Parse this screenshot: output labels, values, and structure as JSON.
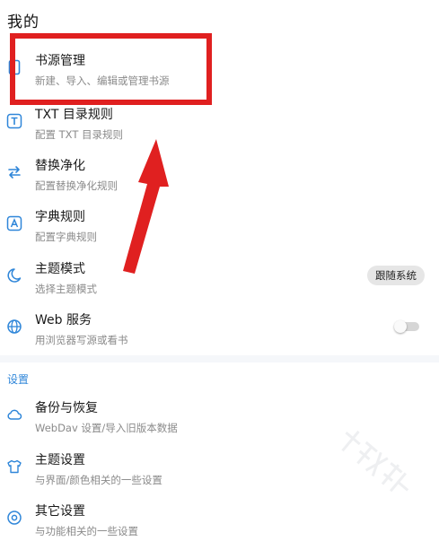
{
  "page": {
    "title": "我的"
  },
  "menu": [
    {
      "icon": "book-icon",
      "title": "书源管理",
      "subtitle": "新建、导入、编辑或管理书源"
    },
    {
      "icon": "text-rule-icon",
      "title": "TXT 目录规则",
      "subtitle": "配置 TXT 目录规则"
    },
    {
      "icon": "swap-icon",
      "title": "替换净化",
      "subtitle": "配置替换净化规则"
    },
    {
      "icon": "dictionary-icon",
      "title": "字典规则",
      "subtitle": "配置字典规则"
    },
    {
      "icon": "theme-icon",
      "title": "主题模式",
      "subtitle": "选择主题模式",
      "chip": "跟随系统"
    },
    {
      "icon": "globe-icon",
      "title": "Web 服务",
      "subtitle": "用浏览器写源或看书",
      "toggle": false
    }
  ],
  "settings": {
    "header": "设置",
    "items": [
      {
        "icon": "cloud-icon",
        "title": "备份与恢复",
        "subtitle": "WebDav 设置/导入旧版本数据"
      },
      {
        "icon": "shirt-icon",
        "title": "主题设置",
        "subtitle": "与界面/颜色相关的一些设置"
      },
      {
        "icon": "other-settings-icon",
        "title": "其它设置",
        "subtitle": "与功能相关的一些设置"
      }
    ]
  },
  "watermark": {
    "text": "千策软件站"
  },
  "colors": {
    "accent": "#2f86d9",
    "annotation": "#e02020",
    "subtitle": "#8a8a8a"
  }
}
